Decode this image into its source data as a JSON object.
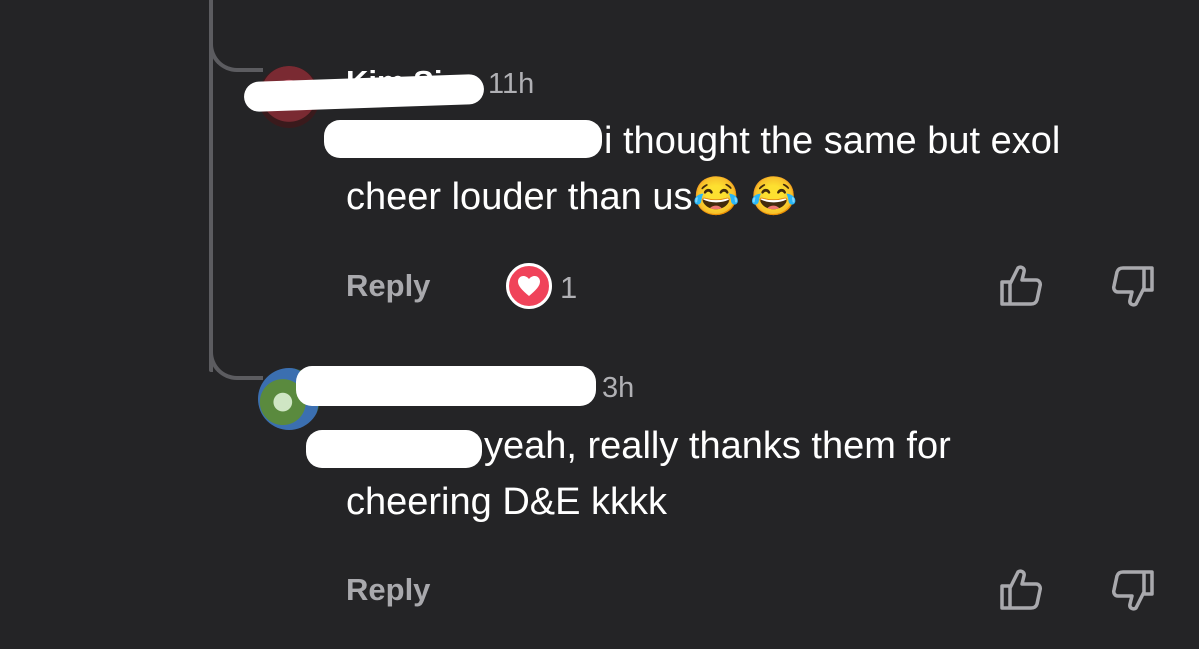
{
  "comments": [
    {
      "name_peek": "Kim Si",
      "time": "11h",
      "text_line1": "i thought the same but exol",
      "text_line2": "cheer louder than us",
      "emojis": "😂 😂",
      "reply_label": "Reply",
      "reaction": {
        "icon": "heart-icon",
        "count": "1"
      }
    },
    {
      "time": "3h",
      "text_line1": "yeah, really thanks them for",
      "text_line2": "cheering D&E kkkk",
      "reply_label": "Reply"
    }
  ],
  "icons": {
    "like": "thumbs-up-icon",
    "dislike": "thumbs-down-icon"
  },
  "colors": {
    "background": "#242426",
    "reaction": "#f0435a",
    "muted": "#a9a9ad"
  }
}
